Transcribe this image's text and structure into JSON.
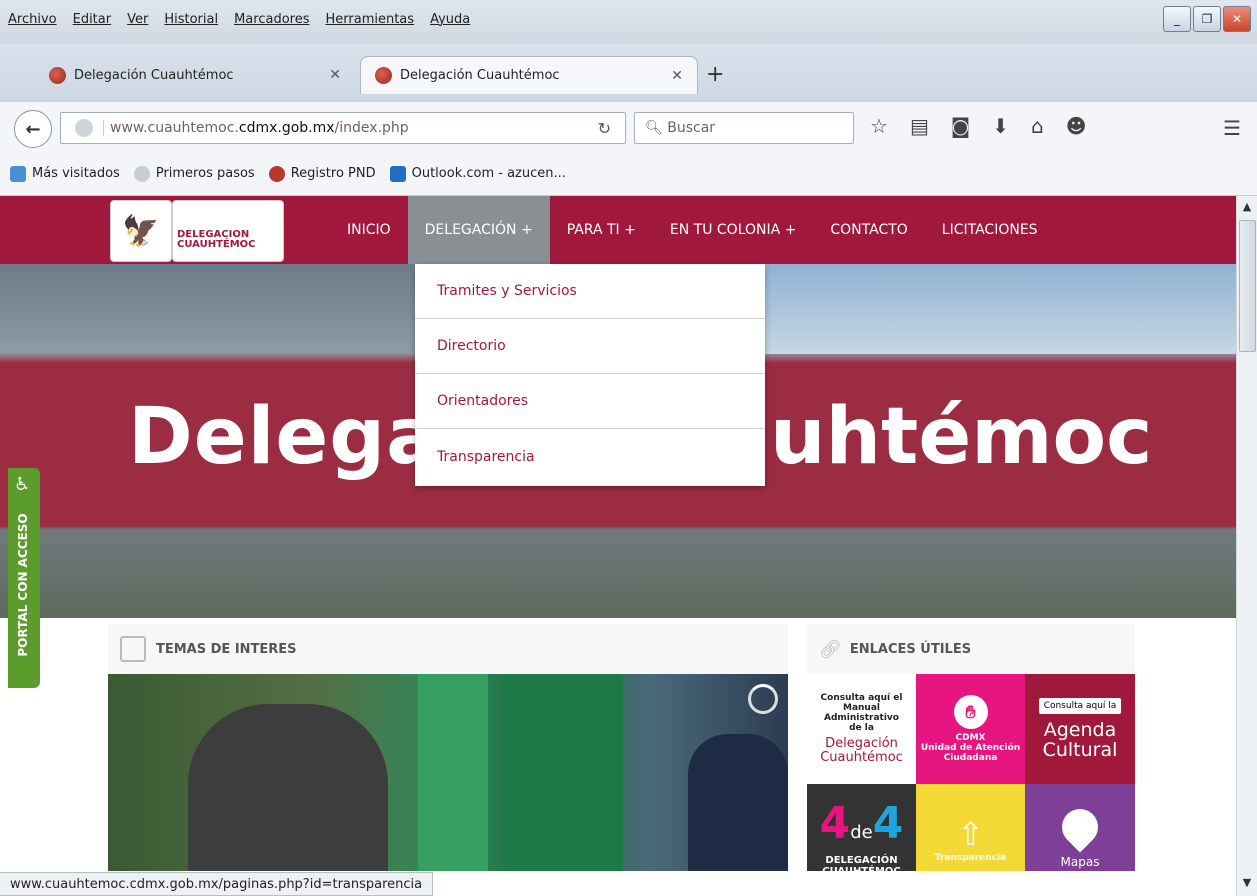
{
  "menubar": {
    "items": [
      "Archivo",
      "Editar",
      "Ver",
      "Historial",
      "Marcadores",
      "Herramientas",
      "Ayuda"
    ]
  },
  "tabs": [
    {
      "title": "Delegación Cuauhtémoc",
      "active": false
    },
    {
      "title": "Delegación Cuauhtémoc",
      "active": true
    }
  ],
  "navbar": {
    "url_prefix": "www.cuauhtemoc.",
    "url_domain": "cdmx.gob.mx",
    "url_suffix": "/index.php",
    "search_placeholder": "Buscar"
  },
  "bookmarks": [
    "Más visitados",
    "Primeros pasos",
    "Registro PND",
    "Outlook.com - azucen..."
  ],
  "site": {
    "logo_line1": "DELEGACION",
    "logo_line2": "CUAUHTÉMOC",
    "nav": [
      "INICIO",
      "DELEGACIÓN +",
      "PARA TI +",
      "EN TU COLONIA +",
      "CONTACTO",
      "LICITACIONES"
    ],
    "dropdown": [
      "Tramites y Servicios",
      "Directorio",
      "Orientadores",
      "Transparencia"
    ],
    "hero_left": "Delega",
    "hero_right": "uhtémoc",
    "access_label": "PORTAL CON ACCESO",
    "temas_title": "TEMAS DE INTERES",
    "enlaces_title": "ENLACES ÚTILES",
    "tiles": {
      "manual_lines": [
        "Consulta aquí el",
        "Manual",
        "Administrativo",
        "de la"
      ],
      "manual_name": "Delegación Cuauhtémoc",
      "cdmx": "CDMX",
      "unidad": "Unidad de Atención Ciudadana",
      "agenda_pill": "Consulta aquí la",
      "agenda": "Agenda Cultural",
      "cuatro_a": "4",
      "cuatro_de": "de",
      "cuatro_b": "4",
      "delegacion_label": "DELEGACIÓN CUAUHTÉMOC",
      "transparencia": "Transparencia",
      "mapas": "Mapas"
    }
  },
  "status_url": "www.cuauhtemoc.cdmx.gob.mx/paginas.php?id=transparencia",
  "colors": {
    "brand": "#a1183d",
    "nav_active": "#8a8f94",
    "access": "#5c9c2c"
  }
}
